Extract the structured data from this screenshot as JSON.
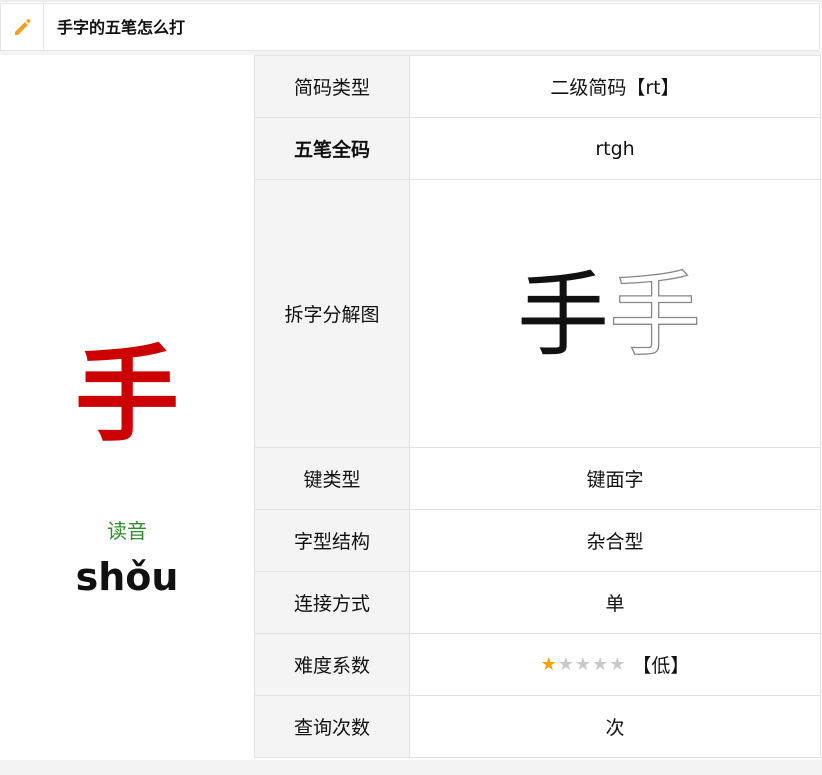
{
  "header": {
    "title": "手字的五笔怎么打",
    "icon": "pencil-icon",
    "icon_color": "#f0a020"
  },
  "character": {
    "glyph": "手",
    "color": "#cc0000",
    "reading_label": "读音",
    "reading_label_color": "#2f8f2f",
    "pinyin": "shǒu"
  },
  "rows": [
    {
      "label": "简码类型",
      "value": "二级简码【rt】"
    },
    {
      "label": "五笔全码",
      "value": "rtgh"
    },
    {
      "label": "拆字分解图",
      "diagram_chars": [
        "手",
        "手"
      ]
    },
    {
      "label": "键类型",
      "value": "键面字"
    },
    {
      "label": "字型结构",
      "value": "杂合型"
    },
    {
      "label": "连接方式",
      "value": "单"
    },
    {
      "label": "难度系数",
      "rating": 1,
      "rating_max": 5,
      "rating_text": "【低】"
    },
    {
      "label": "查询次数",
      "value": "次"
    }
  ],
  "colors": {
    "star_on": "#f5a200",
    "star_off": "#c9c9c9",
    "label_bg": "#f4f4f4"
  }
}
